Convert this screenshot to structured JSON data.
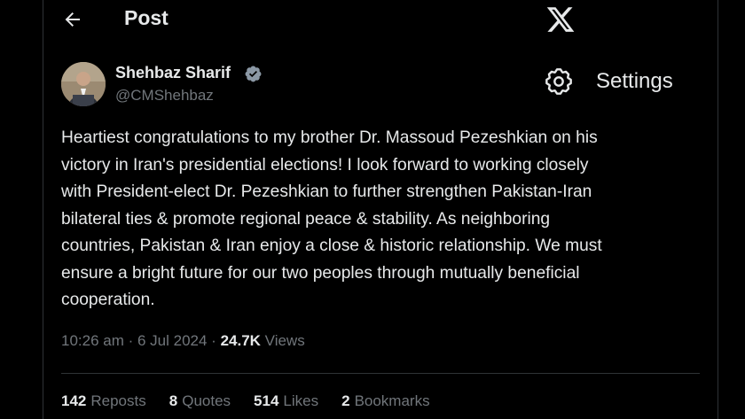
{
  "header": {
    "title": "Post"
  },
  "author": {
    "name": "Shehbaz Sharif",
    "handle": "@CMShehbaz"
  },
  "settings": {
    "label": "Settings"
  },
  "tweet": {
    "text": "Heartiest congratulations to my brother Dr. Massoud Pezeshkian on his\nvictory in Iran's presidential elections! I look forward to working closely\nwith President-elect Dr. Pezeshkian to further strengthen Pakistan-Iran\nbilateral ties & promote regional peace & stability. As neighboring\ncountries, Pakistan & Iran enjoy a close & historic relationship. We must\nensure a bright future for our two peoples through mutually beneficial\ncooperation."
  },
  "meta": {
    "time": "10:26 am",
    "date": "6 Jul 2024",
    "views_count": "24.7K",
    "views_label": "Views"
  },
  "stats": [
    {
      "count": "142",
      "label": "Reposts"
    },
    {
      "count": "8",
      "label": "Quotes"
    },
    {
      "count": "514",
      "label": "Likes"
    },
    {
      "count": "2",
      "label": "Bookmarks"
    }
  ],
  "icons": {
    "back": "arrow-left-icon",
    "logo": "x-logo-icon",
    "verified": "verified-badge-icon",
    "settings": "gear-icon"
  },
  "colors": {
    "background": "#000000",
    "text": "#e7e9ea",
    "muted": "#71767b",
    "verified": "#8b98a5",
    "border": "#2f3336"
  }
}
